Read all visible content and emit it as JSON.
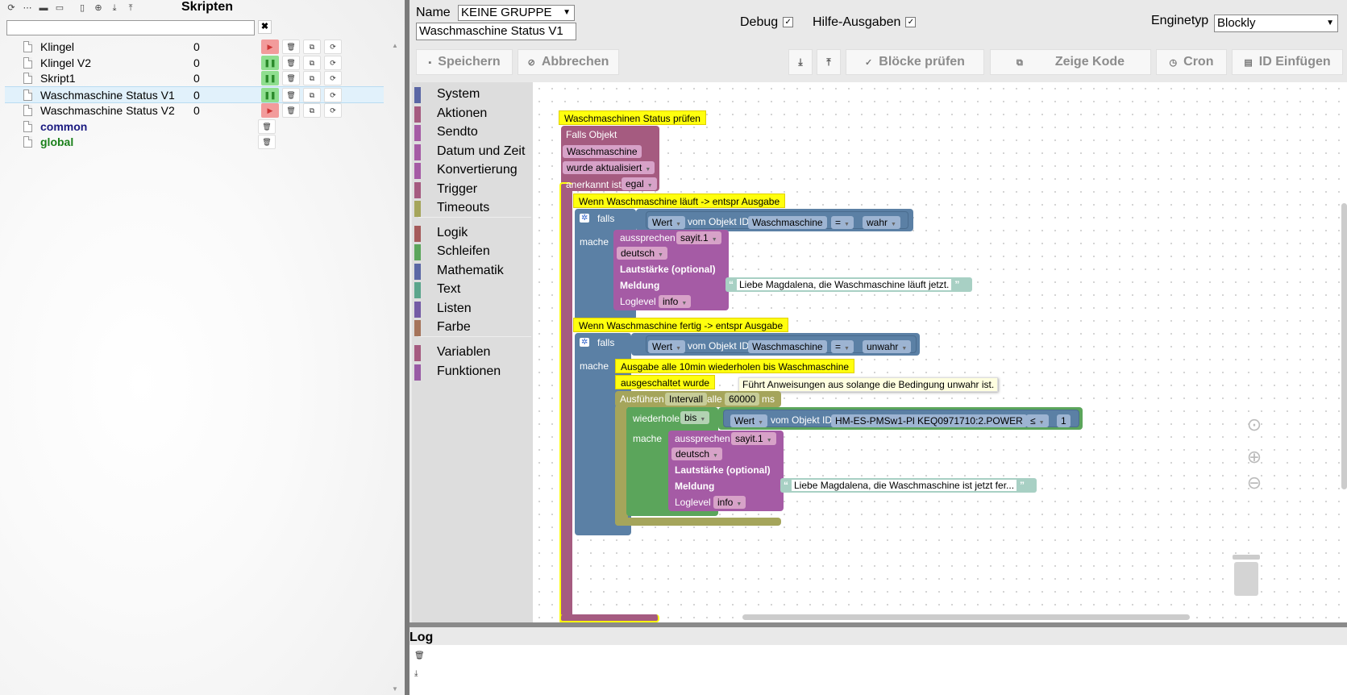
{
  "left": {
    "title": "Skripten",
    "toolbar_icons": [
      "refresh-icon",
      "collapse-icon",
      "folder-icon",
      "folder-open-icon",
      "new-file-icon",
      "add-circle-icon",
      "import-icon",
      "export-icon"
    ],
    "search_placeholder": "",
    "scripts": [
      {
        "name": "Klingel",
        "count": "0",
        "state": "stopped"
      },
      {
        "name": "Klingel V2",
        "count": "0",
        "state": "running"
      },
      {
        "name": "Skript1",
        "count": "0",
        "state": "running"
      },
      {
        "name": "Waschmaschine Status V1",
        "count": "0",
        "state": "running",
        "selected": true
      },
      {
        "name": "Waschmaschine Status V2",
        "count": "0",
        "state": "stopped"
      }
    ],
    "folders": [
      {
        "name": "common",
        "color": "#1a1a80"
      },
      {
        "name": "global",
        "color": "#1a801a"
      }
    ],
    "clear_label": "✖"
  },
  "header": {
    "name_label": "Name",
    "group_value": "KEINE GRUPPE",
    "script_name": "Waschmaschine Status V1",
    "debug_label": "Debug",
    "help_label": "Hilfe-Ausgaben",
    "engine_label": "Enginetyp",
    "engine_value": "Blockly"
  },
  "actions": {
    "save": "Speichern",
    "cancel": "Abbrechen",
    "check": "Blöcke prüfen",
    "show_code": "Zeige Kode",
    "cron": "Cron",
    "insert_id": "ID Einfügen"
  },
  "toolbox": [
    {
      "label": "System",
      "color": "#5b67a5"
    },
    {
      "label": "Aktionen",
      "color": "#a55b80"
    },
    {
      "label": "Sendto",
      "color": "#a55ba5"
    },
    {
      "label": "Datum und Zeit",
      "color": "#a55ba5"
    },
    {
      "label": "Konvertierung",
      "color": "#a55ba5"
    },
    {
      "label": "Trigger",
      "color": "#a55b80"
    },
    {
      "label": "Timeouts",
      "color": "#a5a55b"
    },
    {
      "label": "Logik",
      "color": "#a55b5b"
    },
    {
      "label": "Schleifen",
      "color": "#5ba55b"
    },
    {
      "label": "Mathematik",
      "color": "#5b67a5"
    },
    {
      "label": "Text",
      "color": "#5ba58c"
    },
    {
      "label": "Listen",
      "color": "#745ba5"
    },
    {
      "label": "Farbe",
      "color": "#a5745b"
    },
    {
      "label": "Variablen",
      "color": "#a55b80"
    },
    {
      "label": "Funktionen",
      "color": "#995ba5"
    }
  ],
  "blocks": {
    "comment_main": "Waschmaschinen Status prüfen",
    "trigger_label": "Falls Objekt",
    "trigger_object": "Waschmaschine",
    "trigger_event": "wurde aktualisiert",
    "ack_label": "anerkannt ist",
    "ack_value": "egal",
    "comment_if1": "Wenn Waschmaschine läuft -> entspr Ausgabe",
    "if_label": "falls",
    "do_label": "mache",
    "cond1_value": "Wert",
    "cond_from": "vom Objekt ID",
    "cond1_object": "Waschmaschine",
    "cond_op": "=",
    "cond1_compare": "wahr",
    "speak_label": "aussprechen",
    "speak_device": "sayit.1",
    "speak_lang": "deutsch",
    "volume_label": "Lautstärke (optional)",
    "message_label": "Meldung",
    "msg1": "Liebe Magdalena, die Waschmaschine läuft jetzt.",
    "loglevel_label": "Loglevel",
    "loglevel_value": "info",
    "comment_if2": "Wenn Waschmaschine fertig -> entspr Ausgabe",
    "cond2_compare": "unwahr",
    "comment_repeat": "Ausgabe alle 10min wiederholen bis Waschmaschine",
    "comment_repeat2": "ausgeschaltet wurde",
    "tooltip": "Führt Anweisungen aus solange die Bedingung unwahr ist.",
    "exec_label": "Ausführen",
    "exec_mode": "Intervall",
    "every_label": "alle",
    "interval_value": "60000",
    "ms_label": "ms",
    "repeat_label": "wiederhole",
    "repeat_mode": "bis",
    "cond3_object": "HM-ES-PMSw1-Pl KEQ0971710:2.POWER",
    "cond3_op": "≤",
    "cond3_value": "1",
    "msg2": "Liebe Magdalena, die Waschmaschine ist jetzt fer..."
  },
  "log": {
    "title": "Log"
  },
  "colors": {
    "trigger": "#a55b80",
    "logic": "#5b80a5",
    "speak": "#a55ba5",
    "timeout": "#a5a55b",
    "loop": "#5ba55b",
    "comment": "#ffff0e"
  }
}
